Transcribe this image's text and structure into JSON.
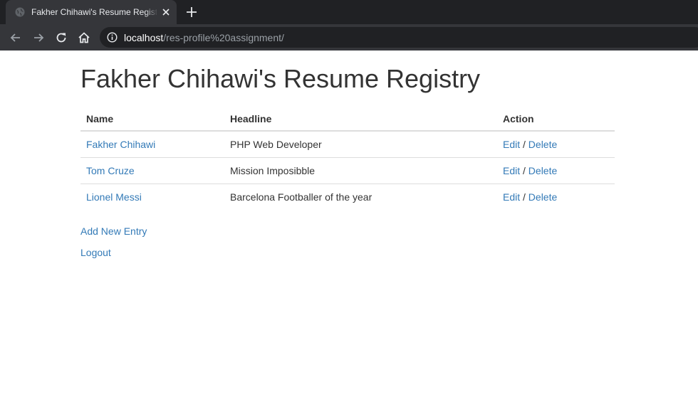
{
  "browser": {
    "tab_title": "Fakher Chihawi's Resume Registry",
    "url_host": "localhost",
    "url_path": "/res-profile%20assignment/"
  },
  "page": {
    "title": "Fakher Chihawi's Resume Registry",
    "table": {
      "headers": {
        "name": "Name",
        "headline": "Headline",
        "action": "Action"
      },
      "rows": [
        {
          "name": "Fakher Chihawi",
          "headline": "PHP Web Developer",
          "edit": "Edit",
          "separator": "/",
          "delete": "Delete"
        },
        {
          "name": "Tom Cruze",
          "headline": "Mission Imposibble",
          "edit": "Edit",
          "separator": "/",
          "delete": "Delete"
        },
        {
          "name": "Lionel Messi",
          "headline": "Barcelona Footballer of the year",
          "edit": "Edit",
          "separator": "/",
          "delete": "Delete"
        }
      ]
    },
    "add_new_entry": "Add New Entry",
    "logout": "Logout"
  },
  "colors": {
    "link": "#337ab7",
    "text": "#333333",
    "chrome_dark": "#202124",
    "chrome_tab": "#35363a"
  },
  "icons": [
    "globe-icon",
    "close-icon",
    "plus-icon",
    "back-arrow-icon",
    "forward-arrow-icon",
    "reload-icon",
    "home-icon",
    "info-icon"
  ]
}
